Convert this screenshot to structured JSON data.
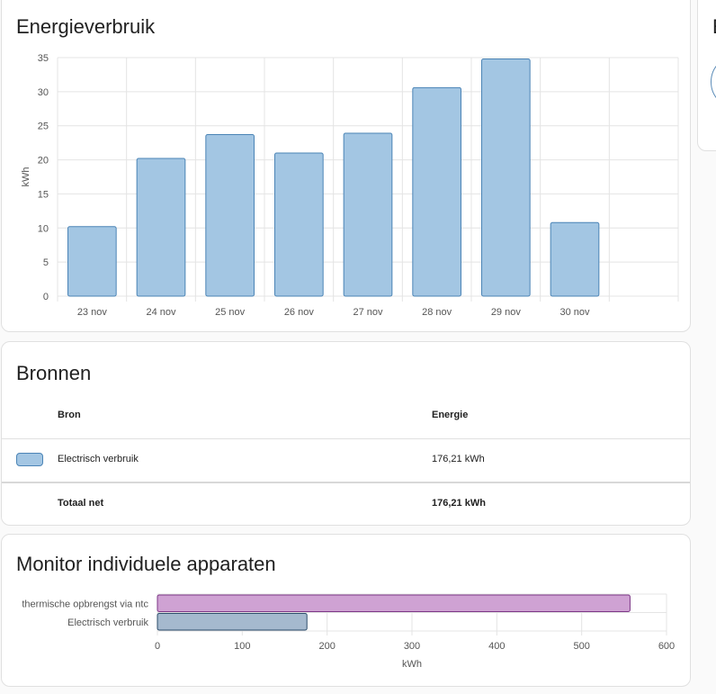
{
  "energy_card": {
    "title": "Energieverbruik"
  },
  "sources_card": {
    "title": "Bronnen",
    "columns": {
      "source": "Bron",
      "energy": "Energie"
    },
    "rows": [
      {
        "label": "Electrisch verbruik",
        "value": "176,21 kWh",
        "color": "#a3c6e3"
      }
    ],
    "total": {
      "label": "Totaal net",
      "value": "176,21 kWh"
    }
  },
  "devices_card": {
    "title": "Monitor individuele apparaten"
  },
  "right_card": {
    "title_partial": "E"
  },
  "colors": {
    "bar_fill": "#a3c6e3",
    "bar_stroke": "#4b84b6",
    "device1_fill": "#cfa2d3",
    "device1_stroke": "#7d3787",
    "device2_fill": "#a5b9ce",
    "device2_stroke": "#2c4d6b"
  },
  "chart_data": [
    {
      "type": "bar",
      "ylabel": "kWh",
      "ylim": [
        0,
        35
      ],
      "yticks": [
        "0",
        "5",
        "10",
        "15",
        "20",
        "25",
        "30",
        "35"
      ],
      "categories": [
        "23 nov",
        "24 nov",
        "25 nov",
        "26 nov",
        "27 nov",
        "28 nov",
        "29 nov",
        "30 nov"
      ],
      "series": [
        {
          "values": [
            10.2,
            20.2,
            23.7,
            21.0,
            23.9,
            30.6,
            34.8,
            10.8
          ]
        }
      ],
      "grid": true
    },
    {
      "type": "bar",
      "orientation": "horizontal",
      "xlabel": "kWh",
      "xlim": [
        0,
        600
      ],
      "xticks": [
        "0",
        "100",
        "200",
        "300",
        "400",
        "500",
        "600"
      ],
      "categories": [
        "thermische opbrengst via ntc",
        "Electrisch verbruik"
      ],
      "series": [
        {
          "values": [
            557,
            176.21
          ]
        }
      ],
      "grid": true
    }
  ]
}
